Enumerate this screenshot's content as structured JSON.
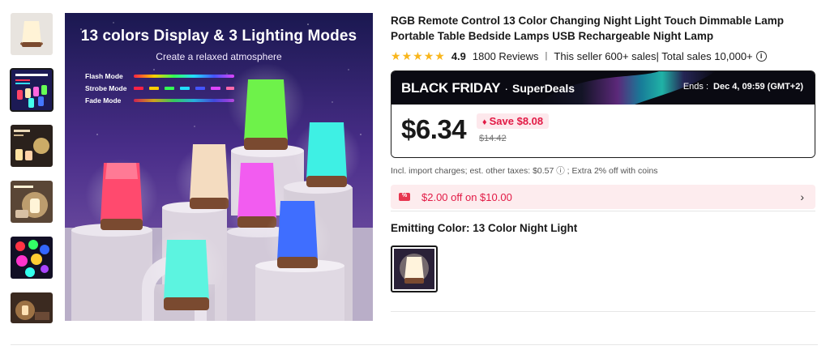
{
  "thumbnails": [
    {
      "icon": "single-lamp-thumbnail",
      "active": false
    },
    {
      "icon": "lamp-modes-thumbnail",
      "active": true
    },
    {
      "icon": "feature-grid-thumbnail",
      "active": false
    },
    {
      "icon": "soothing-light-thumbnail",
      "active": false
    },
    {
      "icon": "color-dots-thumbnail",
      "active": false
    },
    {
      "icon": "bedroom-scene-thumbnail",
      "active": false
    }
  ],
  "hero": {
    "title": "13 colors Display & 3 Lighting Modes",
    "subtitle": "Create a relaxed atmosphere",
    "modes": [
      "Flash Mode",
      "Strobe Mode",
      "Fade Mode"
    ]
  },
  "product": {
    "title": "RGB Remote Control 13 Color Changing Night Light Touch Dimmable Lamp Portable Table Bedside Lamps USB Rechargeable Night Lamp",
    "rating": 4.9,
    "rating_text": "4.9",
    "reviews": "1800 Reviews",
    "separator": "|",
    "sales": "This seller 600+ sales| Total sales 10,000+",
    "info_icon": "i"
  },
  "deal": {
    "event": "BLACK FRIDAY",
    "dot": "·",
    "program": "SuperDeals",
    "ends_label": "Ends :",
    "ends_time": "Dec 4, 09:59 (GMT+2)",
    "price": "$6.34",
    "save": "Save $8.08",
    "original_price": "$14.42"
  },
  "tax_note": "Incl. import charges; est. other taxes: $0.57 ⓘ ; Extra 2% off with coins",
  "coupon": {
    "text": "$2.00 off on $10.00",
    "chevron": "›"
  },
  "variant": {
    "label": "Emitting Color: 13 Color Night Light"
  },
  "colors": {
    "accent": "#e21a45",
    "star": "#f9b61c",
    "coupon_bg": "#fdecee"
  }
}
